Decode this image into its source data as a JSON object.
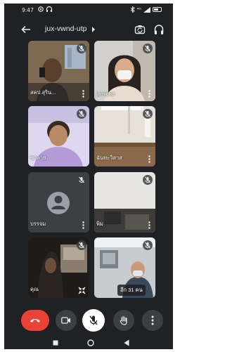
{
  "status_bar": {
    "time": "9:47",
    "network_label": "⁴ᴳ",
    "icons": [
      "gear-icon",
      "headphones-icon",
      "bluetooth-icon",
      "signal-icon",
      "battery-icon"
    ]
  },
  "header": {
    "meeting_code": "jux-vwnd-utp",
    "icons": [
      "back-arrow-icon",
      "chevron-right-icon",
      "camera-switch-icon",
      "audio-output-icon"
    ]
  },
  "participants": [
    {
      "name": "สคป.สุริน...",
      "muted": true
    },
    {
      "name": "jamicha",
      "muted": true
    },
    {
      "name": "ชาลาย",
      "muted": true
    },
    {
      "name": "ฉันทะวิลาส",
      "muted": true
    },
    {
      "name": "บรรจม",
      "muted": true,
      "camera_off": true
    },
    {
      "name": "พิม",
      "muted": true
    },
    {
      "name": "คุณ",
      "muted": true,
      "self": true
    },
    {
      "name": "",
      "muted": true
    }
  ],
  "others_count_label": "อีก 31 คน",
  "controls": {
    "icons": [
      "end-call-icon",
      "camera-icon",
      "mic-off-icon",
      "raise-hand-icon",
      "more-vert-icon"
    ],
    "colors": {
      "end_call": "#ea4335",
      "mic_active_bg": "#ffffff",
      "button_bg": "#3c4043"
    }
  },
  "nav_bar": {
    "icons": [
      "recents-icon",
      "home-icon",
      "back-icon"
    ]
  }
}
